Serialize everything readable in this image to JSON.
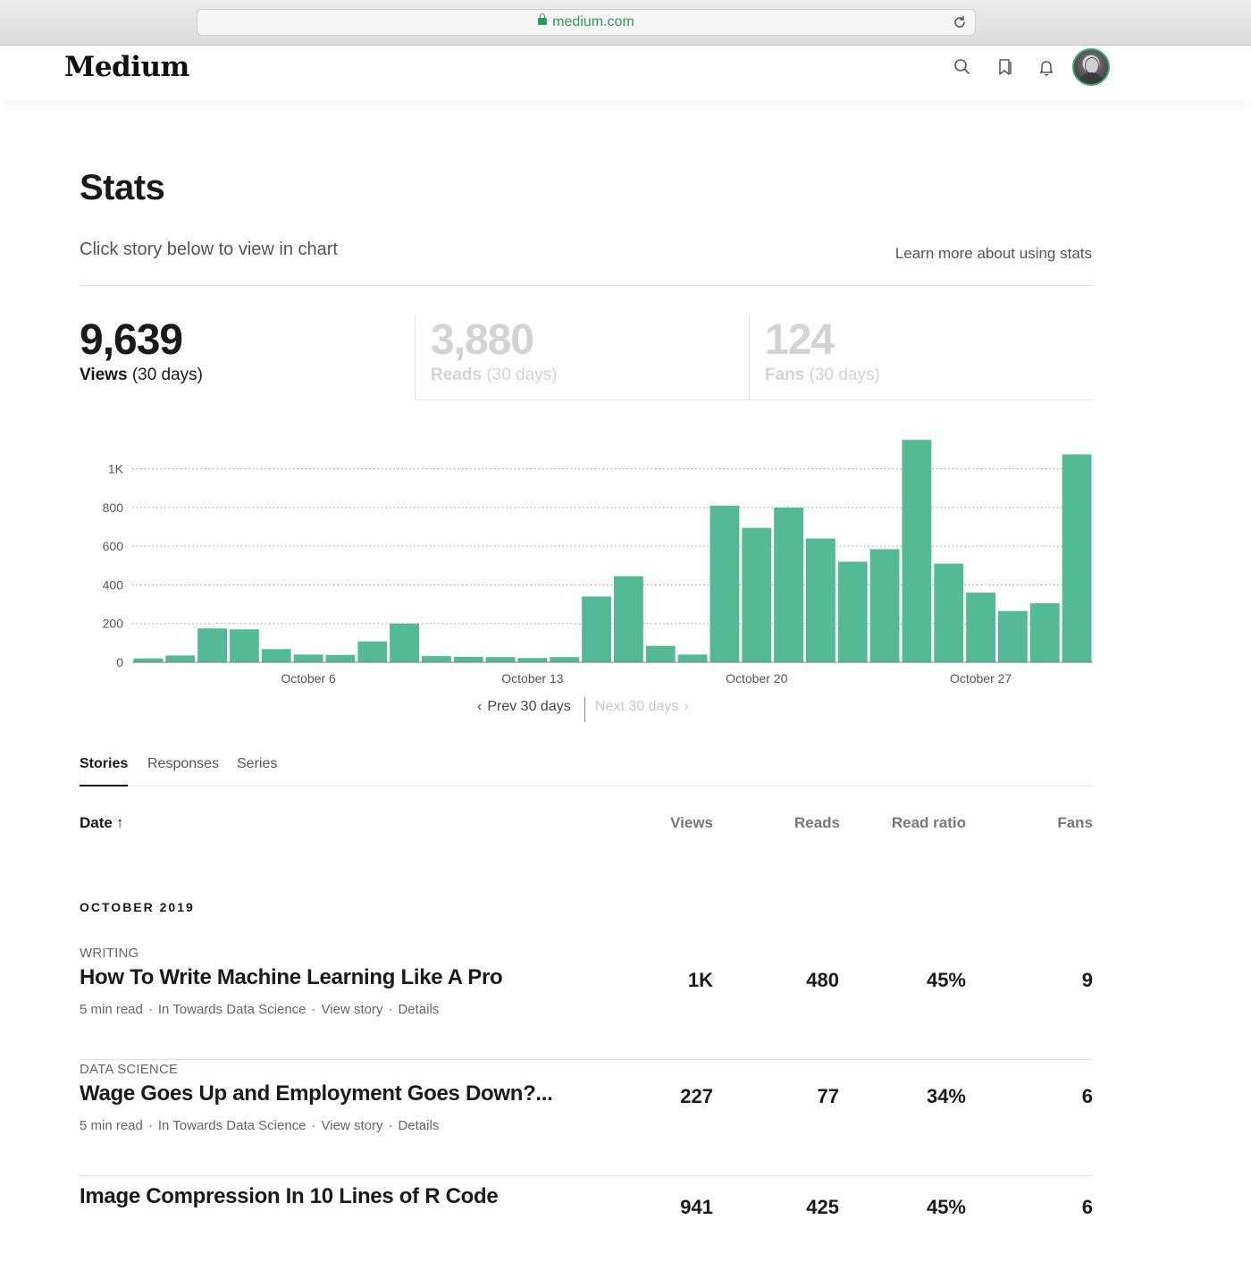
{
  "browser": {
    "url": "medium.com"
  },
  "header": {
    "logo": "Medium"
  },
  "page": {
    "title": "Stats",
    "subtitle": "Click story below to view in chart",
    "learn_more": "Learn more about using stats"
  },
  "summary": {
    "views": {
      "value": "9,639",
      "label": "Views",
      "period": "(30 days)"
    },
    "reads": {
      "value": "3,880",
      "label": "Reads",
      "period": "(30 days)"
    },
    "fans": {
      "value": "124",
      "label": "Fans",
      "period": "(30 days)"
    }
  },
  "chart_data": {
    "type": "bar",
    "values": [
      20,
      35,
      175,
      170,
      68,
      40,
      38,
      108,
      200,
      32,
      28,
      27,
      22,
      27,
      340,
      445,
      85,
      40,
      810,
      695,
      800,
      640,
      520,
      585,
      1150,
      510,
      360,
      265,
      305,
      1075
    ],
    "x_tick_labels": [
      {
        "index": 5.5,
        "label": "October 6"
      },
      {
        "index": 12.5,
        "label": "October 13"
      },
      {
        "index": 19.5,
        "label": "October 20"
      },
      {
        "index": 26.5,
        "label": "October 27"
      }
    ],
    "y_ticks": [
      0,
      200,
      400,
      600,
      800,
      1000
    ],
    "y_tick_labels": [
      "0",
      "200",
      "400",
      "600",
      "800",
      "1K"
    ],
    "ylim": [
      0,
      1160
    ],
    "bar_color": "#54ba95",
    "grid": "dotted horizontal"
  },
  "pager": {
    "prev": "Prev 30 days",
    "next": "Next 30 days"
  },
  "tabs": {
    "stories": "Stories",
    "responses": "Responses",
    "series": "Series"
  },
  "table": {
    "headers": {
      "date": "Date",
      "views": "Views",
      "reads": "Reads",
      "read_ratio": "Read ratio",
      "fans": "Fans"
    },
    "month": "OCTOBER 2019",
    "rows": [
      {
        "category": "WRITING",
        "title": "How To Write Machine Learning Like A Pro",
        "read_time": "5 min read",
        "publication": "In Towards Data Science",
        "view_story": "View story",
        "details": "Details",
        "views": "1K",
        "reads": "480",
        "ratio": "45%",
        "fans": "9"
      },
      {
        "category": "DATA SCIENCE",
        "title": "Wage Goes Up and Employment Goes Down?...",
        "read_time": "5 min read",
        "publication": "In Towards Data Science",
        "view_story": "View story",
        "details": "Details",
        "views": "227",
        "reads": "77",
        "ratio": "34%",
        "fans": "6"
      },
      {
        "category": "",
        "title": "Image Compression In 10 Lines of R Code",
        "read_time": "",
        "publication": "",
        "view_story": "",
        "details": "",
        "views": "941",
        "reads": "425",
        "ratio": "45%",
        "fans": "6"
      }
    ]
  },
  "colors": {
    "accent": "#54ba95",
    "link_green": "#2e9c5c"
  }
}
